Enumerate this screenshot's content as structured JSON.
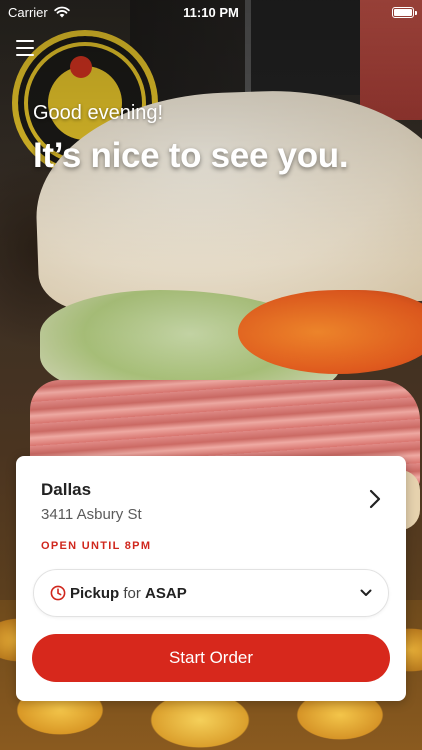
{
  "status_bar": {
    "carrier": "Carrier",
    "time": "11:10 PM",
    "battery_level": 1.0
  },
  "header": {
    "menu_icon": "hamburger-menu-icon",
    "greeting": "Good evening!",
    "headline": "It’s nice to see you."
  },
  "location": {
    "name": "Dallas",
    "address": "3411 Asbury St",
    "status": "OPEN UNTIL 8PM",
    "chevron_icon": "chevron-right-icon"
  },
  "order_mode": {
    "icon": "clock-icon",
    "mode": "Pickup",
    "connector": "for",
    "time": "ASAP",
    "dropdown_icon": "chevron-down-icon"
  },
  "actions": {
    "start_order_label": "Start Order"
  },
  "colors": {
    "accent": "#d7281c",
    "status_text": "#d0271d",
    "card_background": "#ffffff"
  }
}
